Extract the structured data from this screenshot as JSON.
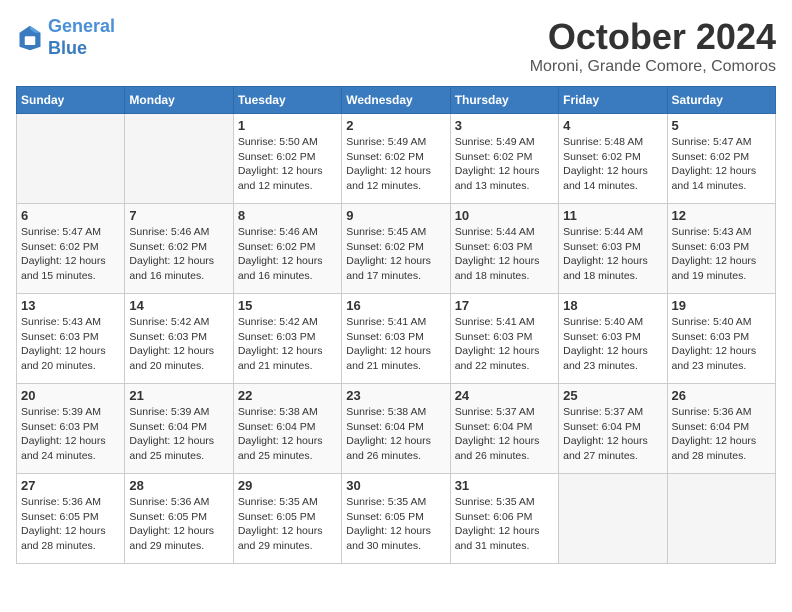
{
  "header": {
    "logo_line1": "General",
    "logo_line2": "Blue",
    "month_title": "October 2024",
    "location": "Moroni, Grande Comore, Comoros"
  },
  "days_of_week": [
    "Sunday",
    "Monday",
    "Tuesday",
    "Wednesday",
    "Thursday",
    "Friday",
    "Saturday"
  ],
  "weeks": [
    [
      {
        "day": "",
        "info": ""
      },
      {
        "day": "",
        "info": ""
      },
      {
        "day": "1",
        "info": "Sunrise: 5:50 AM\nSunset: 6:02 PM\nDaylight: 12 hours\nand 12 minutes."
      },
      {
        "day": "2",
        "info": "Sunrise: 5:49 AM\nSunset: 6:02 PM\nDaylight: 12 hours\nand 12 minutes."
      },
      {
        "day": "3",
        "info": "Sunrise: 5:49 AM\nSunset: 6:02 PM\nDaylight: 12 hours\nand 13 minutes."
      },
      {
        "day": "4",
        "info": "Sunrise: 5:48 AM\nSunset: 6:02 PM\nDaylight: 12 hours\nand 14 minutes."
      },
      {
        "day": "5",
        "info": "Sunrise: 5:47 AM\nSunset: 6:02 PM\nDaylight: 12 hours\nand 14 minutes."
      }
    ],
    [
      {
        "day": "6",
        "info": "Sunrise: 5:47 AM\nSunset: 6:02 PM\nDaylight: 12 hours\nand 15 minutes."
      },
      {
        "day": "7",
        "info": "Sunrise: 5:46 AM\nSunset: 6:02 PM\nDaylight: 12 hours\nand 16 minutes."
      },
      {
        "day": "8",
        "info": "Sunrise: 5:46 AM\nSunset: 6:02 PM\nDaylight: 12 hours\nand 16 minutes."
      },
      {
        "day": "9",
        "info": "Sunrise: 5:45 AM\nSunset: 6:02 PM\nDaylight: 12 hours\nand 17 minutes."
      },
      {
        "day": "10",
        "info": "Sunrise: 5:44 AM\nSunset: 6:03 PM\nDaylight: 12 hours\nand 18 minutes."
      },
      {
        "day": "11",
        "info": "Sunrise: 5:44 AM\nSunset: 6:03 PM\nDaylight: 12 hours\nand 18 minutes."
      },
      {
        "day": "12",
        "info": "Sunrise: 5:43 AM\nSunset: 6:03 PM\nDaylight: 12 hours\nand 19 minutes."
      }
    ],
    [
      {
        "day": "13",
        "info": "Sunrise: 5:43 AM\nSunset: 6:03 PM\nDaylight: 12 hours\nand 20 minutes."
      },
      {
        "day": "14",
        "info": "Sunrise: 5:42 AM\nSunset: 6:03 PM\nDaylight: 12 hours\nand 20 minutes."
      },
      {
        "day": "15",
        "info": "Sunrise: 5:42 AM\nSunset: 6:03 PM\nDaylight: 12 hours\nand 21 minutes."
      },
      {
        "day": "16",
        "info": "Sunrise: 5:41 AM\nSunset: 6:03 PM\nDaylight: 12 hours\nand 21 minutes."
      },
      {
        "day": "17",
        "info": "Sunrise: 5:41 AM\nSunset: 6:03 PM\nDaylight: 12 hours\nand 22 minutes."
      },
      {
        "day": "18",
        "info": "Sunrise: 5:40 AM\nSunset: 6:03 PM\nDaylight: 12 hours\nand 23 minutes."
      },
      {
        "day": "19",
        "info": "Sunrise: 5:40 AM\nSunset: 6:03 PM\nDaylight: 12 hours\nand 23 minutes."
      }
    ],
    [
      {
        "day": "20",
        "info": "Sunrise: 5:39 AM\nSunset: 6:03 PM\nDaylight: 12 hours\nand 24 minutes."
      },
      {
        "day": "21",
        "info": "Sunrise: 5:39 AM\nSunset: 6:04 PM\nDaylight: 12 hours\nand 25 minutes."
      },
      {
        "day": "22",
        "info": "Sunrise: 5:38 AM\nSunset: 6:04 PM\nDaylight: 12 hours\nand 25 minutes."
      },
      {
        "day": "23",
        "info": "Sunrise: 5:38 AM\nSunset: 6:04 PM\nDaylight: 12 hours\nand 26 minutes."
      },
      {
        "day": "24",
        "info": "Sunrise: 5:37 AM\nSunset: 6:04 PM\nDaylight: 12 hours\nand 26 minutes."
      },
      {
        "day": "25",
        "info": "Sunrise: 5:37 AM\nSunset: 6:04 PM\nDaylight: 12 hours\nand 27 minutes."
      },
      {
        "day": "26",
        "info": "Sunrise: 5:36 AM\nSunset: 6:04 PM\nDaylight: 12 hours\nand 28 minutes."
      }
    ],
    [
      {
        "day": "27",
        "info": "Sunrise: 5:36 AM\nSunset: 6:05 PM\nDaylight: 12 hours\nand 28 minutes."
      },
      {
        "day": "28",
        "info": "Sunrise: 5:36 AM\nSunset: 6:05 PM\nDaylight: 12 hours\nand 29 minutes."
      },
      {
        "day": "29",
        "info": "Sunrise: 5:35 AM\nSunset: 6:05 PM\nDaylight: 12 hours\nand 29 minutes."
      },
      {
        "day": "30",
        "info": "Sunrise: 5:35 AM\nSunset: 6:05 PM\nDaylight: 12 hours\nand 30 minutes."
      },
      {
        "day": "31",
        "info": "Sunrise: 5:35 AM\nSunset: 6:06 PM\nDaylight: 12 hours\nand 31 minutes."
      },
      {
        "day": "",
        "info": ""
      },
      {
        "day": "",
        "info": ""
      }
    ]
  ]
}
